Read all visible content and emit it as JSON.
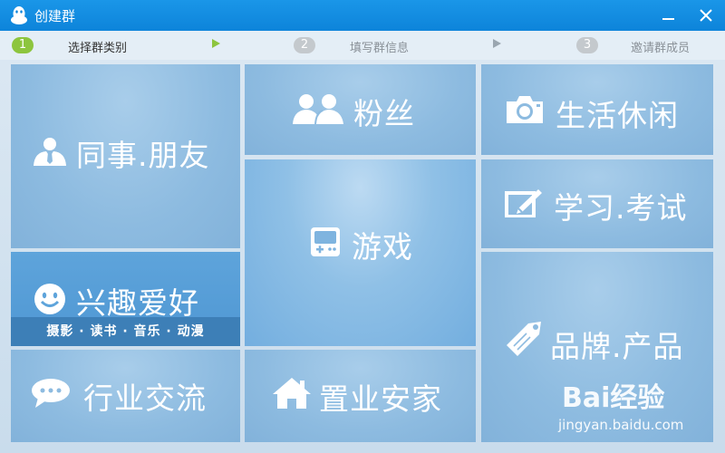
{
  "window": {
    "title": "创建群"
  },
  "steps": [
    {
      "num": "1",
      "label": "选择群类别"
    },
    {
      "num": "2",
      "label": "填写群信息"
    },
    {
      "num": "3",
      "label": "邀请群成员"
    }
  ],
  "tiles": {
    "colleagues": {
      "label": "同事.朋友"
    },
    "fans": {
      "label": "粉丝"
    },
    "life": {
      "label": "生活休闲"
    },
    "study": {
      "label": "学习.考试"
    },
    "games": {
      "label": "游戏"
    },
    "hobby": {
      "label": "兴趣爱好",
      "sub": "摄影 · 读书 · 音乐 · 动漫"
    },
    "brand": {
      "label": "品牌.产品"
    },
    "industry": {
      "label": "行业交流"
    },
    "home": {
      "label": "置业安家"
    }
  },
  "watermark": {
    "text": "Bai经验",
    "url": "jingyan.baidu.com"
  },
  "colors": {
    "titlebar": "#0d84da",
    "tile": "#8dbbe0",
    "hobby_band": "#3d7fb7",
    "step_active": "#8dc53e"
  }
}
